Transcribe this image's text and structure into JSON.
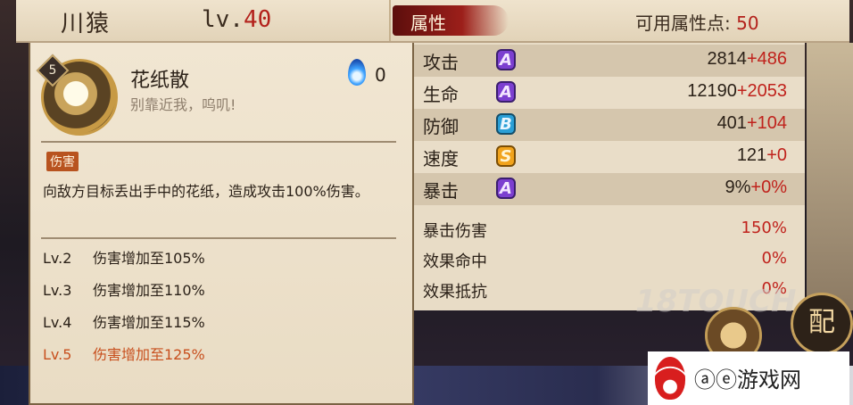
{
  "header": {
    "character_name": "川猿",
    "level_prefix": "lv.",
    "level": "40",
    "attributes_tab": "属性",
    "free_points_label": "可用属性点:",
    "free_points": "50"
  },
  "skill": {
    "level_badge": "5",
    "name": "花纸散",
    "quote": "别靠近我，呜叽!",
    "soul_fire_cost": "0",
    "tag": "伤害",
    "description": "向敌方目标丢出手中的花纸，造成攻击100%伤害。",
    "levels": [
      {
        "lv": "Lv.2",
        "text": "伤害增加至105%"
      },
      {
        "lv": "Lv.3",
        "text": "伤害增加至110%"
      },
      {
        "lv": "Lv.4",
        "text": "伤害增加至115%"
      },
      {
        "lv": "Lv.5",
        "text": "伤害增加至125%"
      }
    ]
  },
  "stats": [
    {
      "label": "攻击",
      "grade": "A",
      "base": "2814",
      "bonus": "+486"
    },
    {
      "label": "生命",
      "grade": "A",
      "base": "12190",
      "bonus": "+2053"
    },
    {
      "label": "防御",
      "grade": "B",
      "base": "401",
      "bonus": "+104"
    },
    {
      "label": "速度",
      "grade": "S",
      "base": "121",
      "bonus": "+0"
    },
    {
      "label": "暴击",
      "grade": "A",
      "base": "9%",
      "bonus": "+0%"
    }
  ],
  "sub_stats": [
    {
      "label": "暴击伤害",
      "value": "150%"
    },
    {
      "label": "效果命中",
      "value": "0%"
    },
    {
      "label": "效果抵抗",
      "value": "0%"
    }
  ],
  "badges": {
    "config_label": "配"
  },
  "watermark": {
    "text": "18TOUCH"
  },
  "logo": {
    "text": "ⓐⓔ游戏网"
  },
  "colors": {
    "accent_red": "#c0221c",
    "grade_A": "#7c3fd0",
    "grade_B": "#2b9fd6",
    "grade_S": "#f1a31c",
    "active_level": "#c8501e"
  }
}
